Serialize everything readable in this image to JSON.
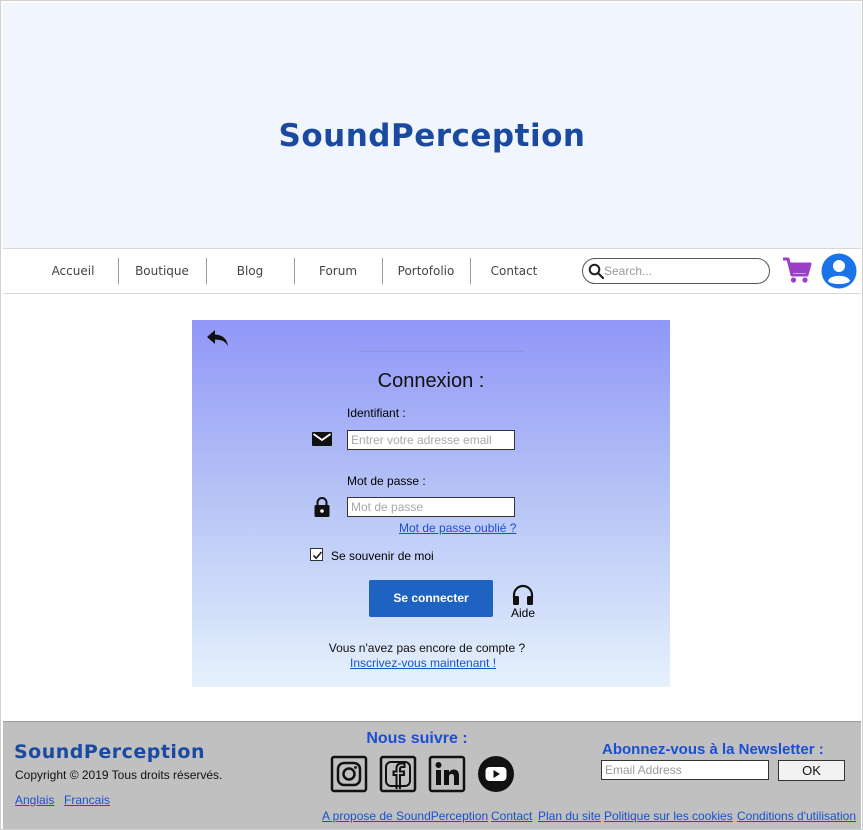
{
  "header": {
    "brand": "SoundPerception"
  },
  "nav": {
    "items": [
      {
        "label": "Accueil"
      },
      {
        "label": "Boutique"
      },
      {
        "label": "Blog"
      },
      {
        "label": "Forum"
      },
      {
        "label": "Portofolio"
      },
      {
        "label": "Contact"
      }
    ],
    "search_placeholder": "Search...",
    "cart_icon": "shopping-cart-icon",
    "account_icon": "user-account-icon",
    "cart_color": "#9b3fc9",
    "account_color": "#1a73e8"
  },
  "login": {
    "title": "Connexion :",
    "identifier_label": "Identifiant :",
    "identifier_placeholder": "Entrer votre adresse email",
    "password_label": "Mot de passe :",
    "password_placeholder": "Mot de passe",
    "forgot_link": "Mot de passe oublié ?",
    "remember_label": "Se souvenir de moi",
    "remember_checked": true,
    "submit_label": "Se connecter",
    "help_label": "Aide",
    "no_account_text": "Vous n'avez pas encore de compte ?",
    "signup_link": "Inscrivez-vous maintenant !",
    "button_color": "#1e63c2"
  },
  "footer": {
    "brand": "SoundPerception",
    "copyright": "Copyright © 2019 Tous droits réservés.",
    "languages": [
      "Anglais",
      "Francais"
    ],
    "follow_title": "Nous suivre :",
    "socials": [
      "instagram-icon",
      "facebook-icon",
      "linkedin-icon",
      "youtube-icon"
    ],
    "newsletter_title": "Abonnez-vous à la Newsletter :",
    "email_placeholder": "Email Address",
    "ok_label": "OK",
    "links": [
      "A propose de SoundPerception",
      "Contact",
      "Plan du site",
      "Politique sur les cookies",
      "Conditions d'utilisation"
    ]
  }
}
